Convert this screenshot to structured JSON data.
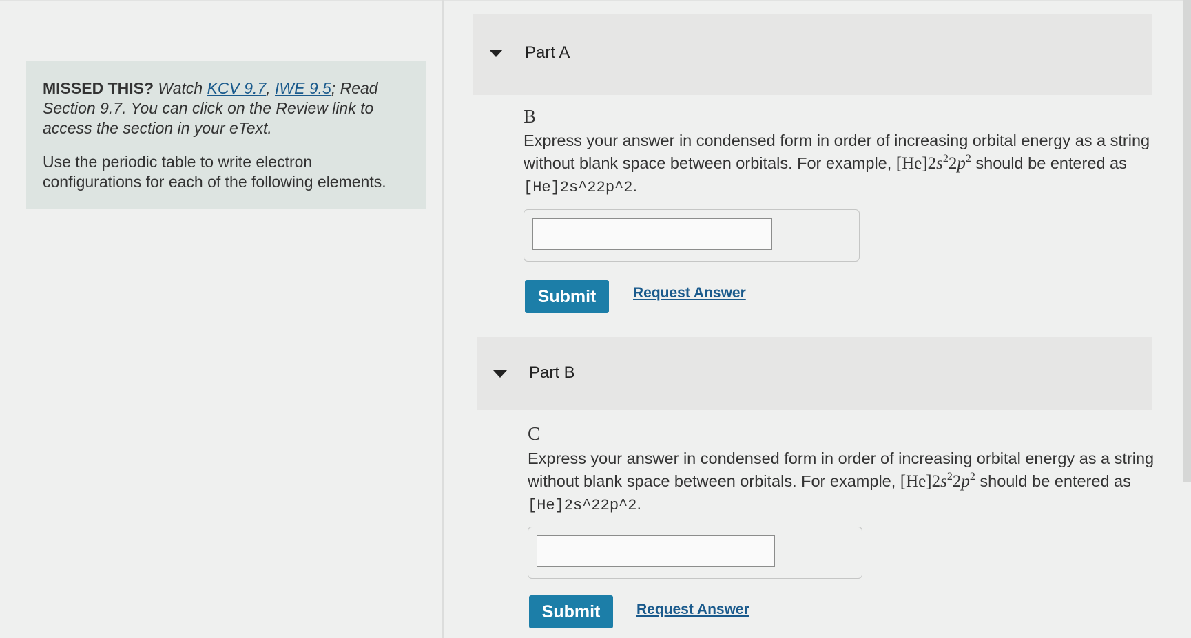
{
  "hint": {
    "missed_label": "MISSED THIS?",
    "watch_text": "Watch",
    "link1": "KCV 9.7",
    "separator": ",",
    "link2": "IWE 9.5",
    "read_text": "; Read Section 9.7. You can click on the Review link to access the section in your eText.",
    "instruction": "Use the periodic table to write electron configurations for each of the following elements."
  },
  "parts": [
    {
      "title": "Part A",
      "element": "B",
      "instr_pre": "Express your answer in condensed form in order of increasing orbital energy as a string without blank space between orbitals. For example,",
      "instr_mid": "should be entered as",
      "example_input": "[He]2s^22p^2",
      "instr_end": ".",
      "input_value": "",
      "submit_label": "Submit",
      "request_label": "Request Answer"
    },
    {
      "title": "Part B",
      "element": "C",
      "instr_pre": "Express your answer in condensed form in order of increasing orbital energy as a string without blank space between orbitals. For example,",
      "instr_mid": "should be entered as",
      "example_input": "[He]2s^22p^2",
      "instr_end": ".",
      "input_value": "",
      "submit_label": "Submit",
      "request_label": "Request Answer"
    }
  ],
  "example_math": {
    "bracket": "[He]",
    "n1": "2",
    "orb1": "s",
    "exp1": "2",
    "n2": "2",
    "orb2": "p",
    "exp2": "2"
  }
}
